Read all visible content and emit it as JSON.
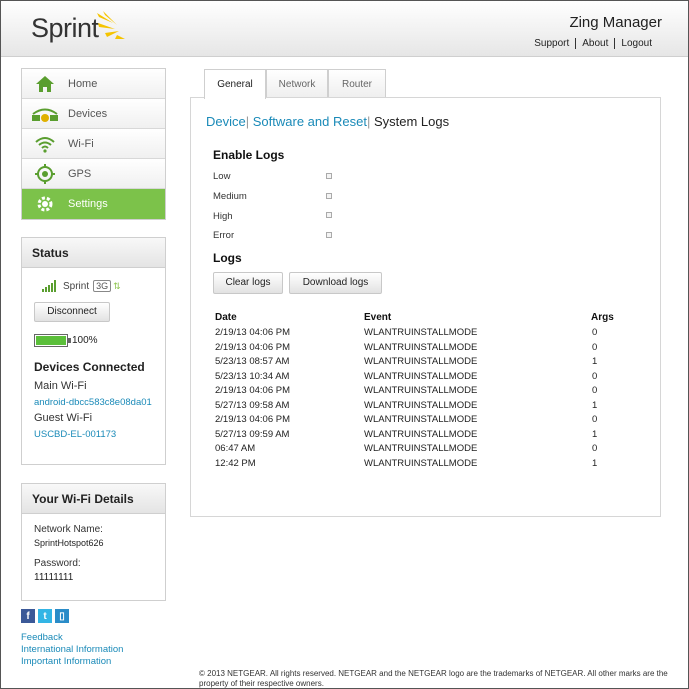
{
  "header": {
    "brand": "Sprint",
    "app_title": "Zing Manager",
    "links": [
      "Support",
      "About",
      "Logout"
    ]
  },
  "nav": {
    "items": [
      {
        "label": "Home",
        "icon": "home-icon"
      },
      {
        "label": "Devices",
        "icon": "devices-icon"
      },
      {
        "label": "Wi-Fi",
        "icon": "wifi-icon"
      },
      {
        "label": "GPS",
        "icon": "gps-icon"
      },
      {
        "label": "Settings",
        "icon": "gear-icon",
        "active": true
      }
    ]
  },
  "status": {
    "title": "Status",
    "carrier": "Sprint",
    "network_type": "3G",
    "disconnect_label": "Disconnect",
    "battery_percent": 100,
    "battery_label": "100%",
    "devices_connected_title": "Devices Connected",
    "main_wifi_label": "Main Wi-Fi",
    "main_wifi_device": "android-dbcc583c8e08da01",
    "guest_wifi_label": "Guest Wi-Fi",
    "guest_wifi_device": "USCBD-EL-001173"
  },
  "wifi_details": {
    "title": "Your Wi-Fi Details",
    "network_name_label": "Network Name:",
    "network_name": "SprintHotspot626",
    "password_label": "Password:",
    "password": "11111111"
  },
  "social": {
    "icons": [
      "facebook-icon",
      "twitter-icon",
      "blog-icon"
    ],
    "colors": {
      "facebook": "#3b5998",
      "twitter": "#33b5e5",
      "blog": "#2a8cc8"
    }
  },
  "footer_links": [
    "Feedback",
    "International Information",
    "Important Information"
  ],
  "tabs": [
    {
      "label": "General",
      "active": true
    },
    {
      "label": "Network",
      "active": false
    },
    {
      "label": "Router",
      "active": false
    }
  ],
  "subnav": {
    "device": "Device",
    "software_reset": "Software and Reset",
    "system_logs": "System Logs"
  },
  "enable_logs": {
    "title": "Enable Logs",
    "options": [
      {
        "label": "Low",
        "checked": false
      },
      {
        "label": "Medium",
        "checked": false
      },
      {
        "label": "High",
        "checked": false
      },
      {
        "label": "Error",
        "checked": false
      }
    ]
  },
  "logs": {
    "title": "Logs",
    "clear_label": "Clear logs",
    "download_label": "Download logs",
    "columns": {
      "date": "Date",
      "event": "Event",
      "args": "Args"
    },
    "rows": [
      {
        "date": "2/19/13 04:06 PM",
        "event": "WLANTRUINSTALLMODE",
        "args": "0"
      },
      {
        "date": "2/19/13 04:06 PM",
        "event": "WLANTRUINSTALLMODE",
        "args": "0"
      },
      {
        "date": "5/23/13 08:57 AM",
        "event": "WLANTRUINSTALLMODE",
        "args": "1"
      },
      {
        "date": "5/23/13 10:34 AM",
        "event": "WLANTRUINSTALLMODE",
        "args": "0"
      },
      {
        "date": "2/19/13 04:06 PM",
        "event": "WLANTRUINSTALLMODE",
        "args": "0"
      },
      {
        "date": "5/27/13 09:58 AM",
        "event": "WLANTRUINSTALLMODE",
        "args": "1"
      },
      {
        "date": "2/19/13 04:06 PM",
        "event": "WLANTRUINSTALLMODE",
        "args": "0"
      },
      {
        "date": "5/27/13 09:59 AM",
        "event": "WLANTRUINSTALLMODE",
        "args": "1"
      },
      {
        "date": "06:47 AM",
        "event": "WLANTRUINSTALLMODE",
        "args": "0"
      },
      {
        "date": "12:42 PM",
        "event": "WLANTRUINSTALLMODE",
        "args": "1"
      }
    ]
  },
  "copyright": "© 2013 NETGEAR. All rights reserved. NETGEAR and the NETGEAR logo are the trademarks of NETGEAR. All other marks are the property of their respective owners.",
  "colors": {
    "accent_green": "#7cc24a",
    "link_blue": "#1a8ab8",
    "sprint_yellow": "#f5c400"
  }
}
